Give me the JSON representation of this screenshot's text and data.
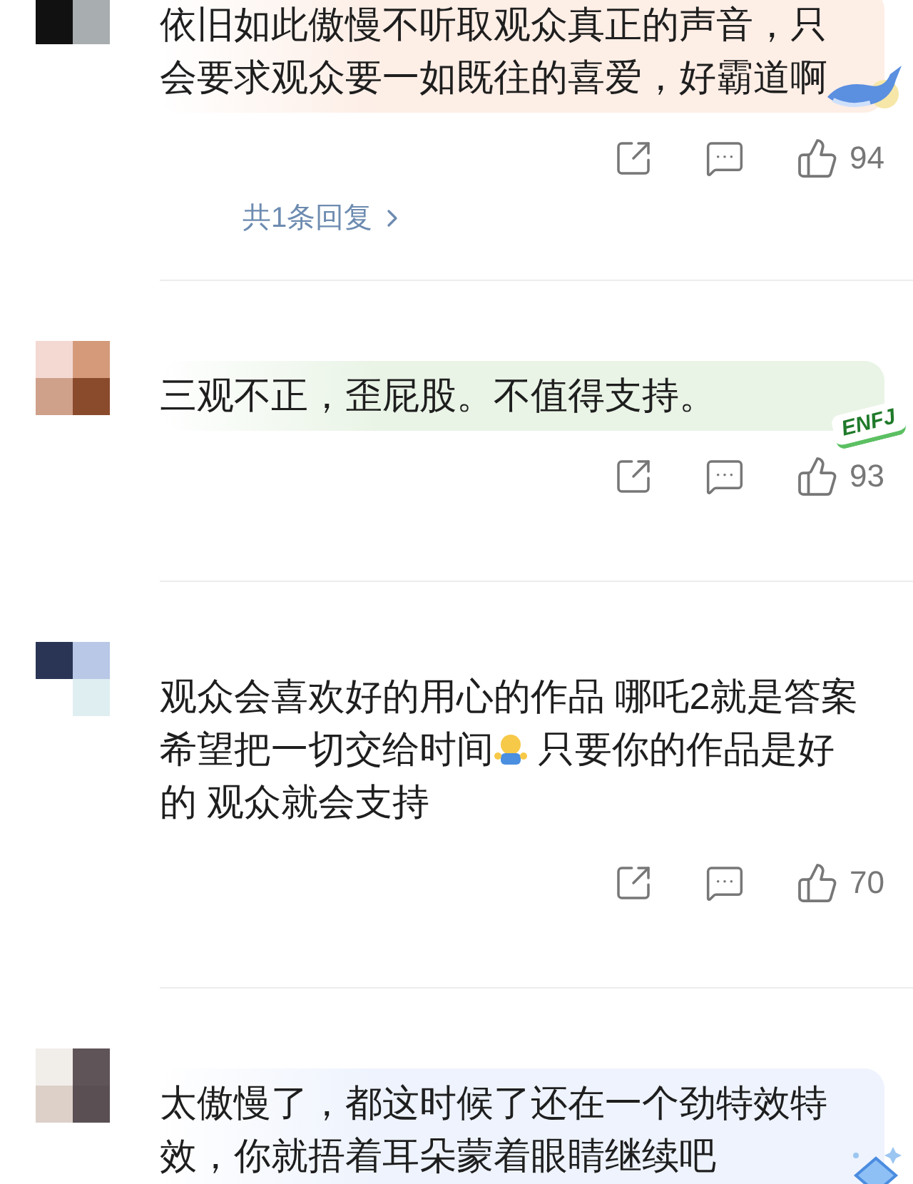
{
  "comments": [
    {
      "color": "#fdeee6",
      "segments": [
        {
          "kind": "text",
          "text": "依旧如此傲慢不听取观众真正的声音，只会要求观众要一如既往的喜爱，好霸道啊"
        }
      ],
      "sticker": {
        "kind": "whale"
      },
      "likes": "94",
      "replies": "共1条回复"
    },
    {
      "color": "#e9f4e6",
      "segments": [
        {
          "kind": "text",
          "text": "三观不正，歪屁股。不值得支持。"
        }
      ],
      "sticker": {
        "kind": "badge",
        "text": "ENFJ"
      },
      "likes": "93"
    },
    {
      "segments": [
        {
          "kind": "text",
          "text": "观众会喜欢好的用心的作品 哪吒2就是答案"
        },
        {
          "kind": "text",
          "text": "希望把一切交给时间"
        },
        {
          "kind": "emoji"
        },
        {
          "kind": "text",
          "text": " 只要你的作品是好"
        },
        {
          "kind": "text",
          "text": "的 观众就会支持"
        }
      ],
      "likes": "70"
    },
    {
      "color": "#eef3fd",
      "segments": [
        {
          "kind": "text",
          "text": "太傲慢了，都这时候了还在一个劲特效特效，你就捂着耳朵蒙着眼睛继续吧"
        }
      ],
      "sticker": {
        "kind": "gem"
      }
    }
  ]
}
